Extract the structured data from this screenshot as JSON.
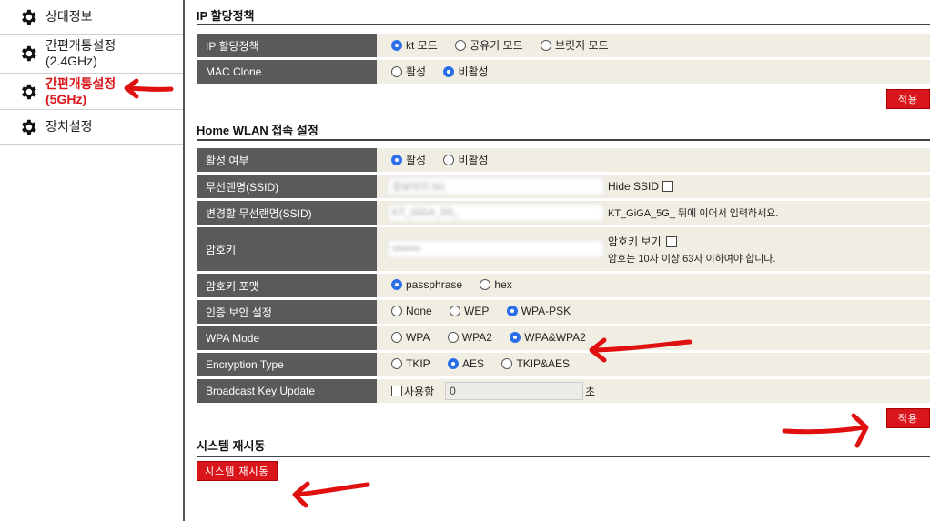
{
  "sidebar": {
    "items": [
      {
        "label": "상태정보"
      },
      {
        "label_line1": "간편개통설정",
        "label_line2": "(2.4GHz)"
      },
      {
        "label_line1": "간편개통설정",
        "label_line2": "(5GHz)"
      },
      {
        "label": "장치설정"
      }
    ]
  },
  "ip_section": {
    "title": "IP 할당정책",
    "ip_policy_label": "IP 할당정책",
    "ip_policy_options": [
      "kt 모드",
      "공유기 모드",
      "브릿지 모드"
    ],
    "ip_policy_selected": "kt 모드",
    "mac_clone_label": "MAC Clone",
    "mac_clone_options": [
      "활성",
      "비활성"
    ],
    "mac_clone_selected": "비활성",
    "apply_label": "적용"
  },
  "wlan_section": {
    "title": "Home WLAN 접속 설정",
    "enable_label": "활성 여부",
    "enable_options": [
      "활성",
      "비활성"
    ],
    "enable_selected": "활성",
    "ssid_label": "무선랜명(SSID)",
    "ssid_value": "정보미지 5G",
    "hide_ssid_label": "Hide SSID",
    "change_ssid_label": "변경할 무선랜명(SSID)",
    "change_ssid_value": "KT_GiGA_5G_",
    "change_ssid_hint": "KT_GiGA_5G_ 뒤에 이어서 입력하세요.",
    "key_label": "암호키",
    "key_value": "••••••••",
    "show_key_label": "암호키 보기",
    "key_hint": "암호는 10자 이상 63자 이하여야 합니다.",
    "key_format_label": "암호키 포맷",
    "key_format_options": [
      "passphrase",
      "hex"
    ],
    "key_format_selected": "passphrase",
    "auth_label": "인증 보안 설정",
    "auth_options": [
      "None",
      "WEP",
      "WPA-PSK"
    ],
    "auth_selected": "WPA-PSK",
    "wpa_mode_label": "WPA Mode",
    "wpa_mode_options": [
      "WPA",
      "WPA2",
      "WPA&WPA2"
    ],
    "wpa_mode_selected": "WPA&WPA2",
    "encryption_label": "Encryption Type",
    "encryption_options": [
      "TKIP",
      "AES",
      "TKIP&AES"
    ],
    "encryption_selected": "AES",
    "broadcast_label": "Broadcast Key Update",
    "broadcast_use_label": "사용함",
    "broadcast_value": "0",
    "broadcast_unit": "초",
    "apply_label": "적용"
  },
  "reboot_section": {
    "title": "시스템 재시동",
    "button_label": "시스템 재시동"
  },
  "colors": {
    "accent_red": "#d9161b",
    "label_bg": "#5a5a5a",
    "value_bg": "#f0ede2",
    "radio_selected": "#2a6ee8"
  },
  "annotations": [
    "red-arrow-sidebar",
    "red-arrow-wpa-mode",
    "red-arrow-apply",
    "red-arrow-reboot"
  ]
}
